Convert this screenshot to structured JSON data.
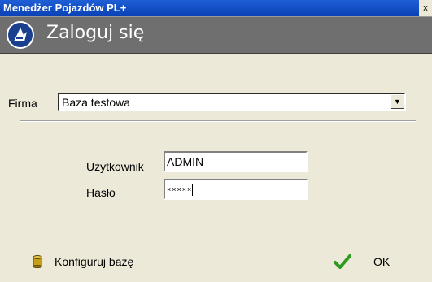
{
  "window": {
    "title": "Menedżer Pojazdów PL+",
    "close_label": "x"
  },
  "header": {
    "title": "Zaloguj się",
    "icon": "app-logo-icon"
  },
  "firma": {
    "label": "Firma",
    "value": "Baza testowa",
    "dropdown_icon": "chevron-down-icon"
  },
  "login": {
    "user_label": "Użytkownik",
    "user_value": "ADMIN",
    "password_label": "Hasło",
    "password_value": "×××××"
  },
  "buttons": {
    "config_label": "Konfiguruj bazę",
    "config_icon": "database-icon",
    "ok_label": "OK",
    "ok_icon": "checkmark-icon"
  },
  "colors": {
    "title_blue": "#0b41b5",
    "header_gray": "#6f6f6f",
    "dialog_bg": "#ece9d8",
    "check_green": "#2e9a1e",
    "db_gold": "#c8a018"
  }
}
